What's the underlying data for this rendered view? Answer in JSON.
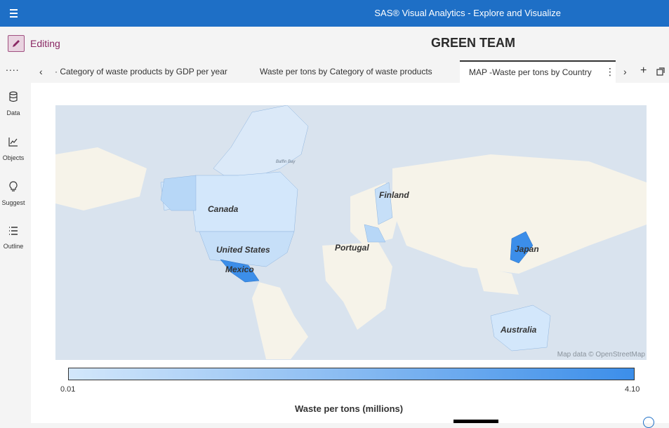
{
  "app": {
    "title": "SAS® Visual Analytics - Explore and Visualize"
  },
  "editbar": {
    "mode_label": "Editing",
    "report_title": "GREEN TEAM"
  },
  "leftnav": {
    "more": "....",
    "items": [
      {
        "label": "Data",
        "icon": "database-icon"
      },
      {
        "label": "Objects",
        "icon": "chart-icon"
      },
      {
        "label": "Suggest",
        "icon": "lightbulb-icon"
      },
      {
        "label": "Outline",
        "icon": "outline-icon"
      }
    ]
  },
  "tabs": [
    {
      "label": "· Category of waste products by GDP per year",
      "active": false
    },
    {
      "label": "Waste per tons by Category of waste products",
      "active": false
    },
    {
      "label": "MAP -Waste per tons by Country",
      "active": true
    }
  ],
  "tab_controls": {
    "prev": "‹",
    "menu": "⋮",
    "next": "›",
    "add": "+"
  },
  "map": {
    "attribution": "Map data © OpenStreetMap",
    "ocean_color": "#d9e3ee",
    "land_color": "#f6f3e9",
    "labels": [
      "Canada",
      "United States",
      "Mexico",
      "Portugal",
      "Finland",
      "Japan",
      "Australia"
    ],
    "small_labels": [
      "Baffin Bay"
    ]
  },
  "legend": {
    "min": "0.01",
    "max": "4.10",
    "title": "Waste per tons (millions)",
    "color_low": "#d3e7fb",
    "color_high": "#3c8ee9"
  }
}
